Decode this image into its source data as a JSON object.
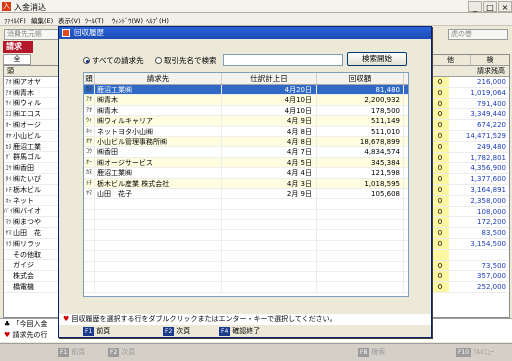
{
  "main": {
    "title": "入金消込",
    "menu": [
      "ﾌｧｲﾙ(F)",
      "編集(E)",
      "表示(V)",
      "ﾂｰﾙ(T)",
      "ｳｨﾝﾄﾞｳ(W)",
      "ﾍﾙﾌﾟ(H)"
    ],
    "prev_customer": "消費先元帳",
    "next_customer": "虎の巻",
    "section_label": "請求",
    "tab_all": "全",
    "left_header": "頭",
    "left_rows": [
      {
        "kana": "ｱｵ",
        "name": "㈱アオヤ"
      },
      {
        "kana": "ｱｵ",
        "name": "㈱青木"
      },
      {
        "kana": "ｳｨ",
        "name": "㈱ウィル"
      },
      {
        "kana": "ｴｺ",
        "name": "㈱エコス"
      },
      {
        "kana": "ｵｰ",
        "name": "㈱オージ"
      },
      {
        "kana": "ｵﾔ",
        "name": "小山ビル"
      },
      {
        "kana": "ｶﾇ",
        "name": "鹿沼工業"
      },
      {
        "kana": "ｸﾞ",
        "name": "群馬ゴル"
      },
      {
        "kana": "ｺｳ",
        "name": "㈱香田"
      },
      {
        "kana": "ﾀｲ",
        "name": "㈱たいぴ"
      },
      {
        "kana": "ﾄﾁ",
        "name": "栃木ビル"
      },
      {
        "kana": "ﾈｯ",
        "name": "ネット"
      },
      {
        "kana": "ﾊﾞｲ",
        "name": "㈱バイオ"
      },
      {
        "kana": "ﾏﾂ",
        "name": "㈱まつや"
      },
      {
        "kana": "ﾔﾏ",
        "name": "山田　花"
      },
      {
        "kana": "ﾘﾗ",
        "name": "㈱リラッ"
      },
      {
        "kana": "",
        "name": "その他取"
      },
      {
        "kana": "",
        "name": "ガイジ"
      },
      {
        "kana": "",
        "name": "株式会"
      },
      {
        "kana": "",
        "name": "橋電機"
      }
    ],
    "right_headers": [
      "他",
      "検"
    ],
    "right_subheader": "請求残高",
    "right_rows": [
      {
        "flag": "0",
        "amount": "216,000"
      },
      {
        "flag": "0",
        "amount": "1,019,064"
      },
      {
        "flag": "0",
        "amount": "791,400"
      },
      {
        "flag": "0",
        "amount": "3,349,440"
      },
      {
        "flag": "0",
        "amount": "674,220"
      },
      {
        "flag": "0",
        "amount": "14,471,529"
      },
      {
        "flag": "0",
        "amount": "249,480"
      },
      {
        "flag": "0",
        "amount": "1,782,801"
      },
      {
        "flag": "0",
        "amount": "4,356,900"
      },
      {
        "flag": "0",
        "amount": "1,377,600"
      },
      {
        "flag": "0",
        "amount": "3,164,891"
      },
      {
        "flag": "0",
        "amount": "2,358,000"
      },
      {
        "flag": "0",
        "amount": "108,000"
      },
      {
        "flag": "0",
        "amount": "172,200"
      },
      {
        "flag": "0",
        "amount": "83,500"
      },
      {
        "flag": "0",
        "amount": "3,154,500"
      },
      {
        "flag": "",
        "amount": ""
      },
      {
        "flag": "0",
        "amount": "73,500"
      },
      {
        "flag": "0",
        "amount": "357,000"
      },
      {
        "flag": "0",
        "amount": "252,000"
      }
    ],
    "bottom_msg": "「今回入金",
    "bottom_msg2": "請求先の行",
    "fkeys": [
      {
        "key": "F1",
        "label": "前頁"
      },
      {
        "key": "F2",
        "label": "次頁"
      },
      {
        "key": "F8",
        "label": "検索"
      },
      {
        "key": "F10",
        "label": "ﾌﾙﾒﾆｭｰ"
      }
    ]
  },
  "dialog": {
    "title": "回収履歴",
    "radio_all": "すべての請求先",
    "radio_search": "取引先名で検索",
    "search_value": "",
    "search_button": "検索開始",
    "columns": [
      "頭",
      "請求先",
      "仕訳計上日",
      "回収額"
    ],
    "rows": [
      {
        "kana": "ｶﾇ",
        "name": "鹿沼工業㈱",
        "date": "4月20日",
        "amount": "81,480"
      },
      {
        "kana": "ｱｵ",
        "name": "㈱青木",
        "date": "4月10日",
        "amount": "2,200,932"
      },
      {
        "kana": "ｱｵ",
        "name": "㈱青木",
        "date": "4月10日",
        "amount": "178,500"
      },
      {
        "kana": "ｳｨ",
        "name": "㈱ウィルキャリア",
        "date": "4月 9日",
        "amount": "511,149"
      },
      {
        "kana": "ﾈｯ",
        "name": "ネットヨタ小山㈱",
        "date": "4月 8日",
        "amount": "511,010"
      },
      {
        "kana": "ｵﾔ",
        "name": "小山ビル管理事務所㈱",
        "date": "4月 8日",
        "amount": "18,678,899"
      },
      {
        "kana": "ｺｳ",
        "name": "㈱香田",
        "date": "4月 7日",
        "amount": "4,834,574"
      },
      {
        "kana": "ｵｰ",
        "name": "㈱オージサービス",
        "date": "4月 5日",
        "amount": "345,384"
      },
      {
        "kana": "ｶﾇ",
        "name": "鹿沼工業㈱",
        "date": "4月 4日",
        "amount": "121,598"
      },
      {
        "kana": "ﾄﾁ",
        "name": "栃木ビル産業 株式会社",
        "date": "4月 3日",
        "amount": "1,018,595"
      },
      {
        "kana": "ﾔﾏ",
        "name": "山田　花子",
        "date": "2月 9日",
        "amount": "105,608"
      }
    ],
    "message": "回収履歴を選択する行をダブルクリックまたはエンター・キーで選択してください。",
    "keys": [
      {
        "key": "F1",
        "label": "前頁"
      },
      {
        "key": "F2",
        "label": "次頁"
      },
      {
        "key": "F4",
        "label": "確認終了"
      }
    ],
    "colors": {
      "title_bar": "#2a63d8",
      "selected_row": "#316ac5",
      "accent_red": "#b5182b"
    }
  }
}
